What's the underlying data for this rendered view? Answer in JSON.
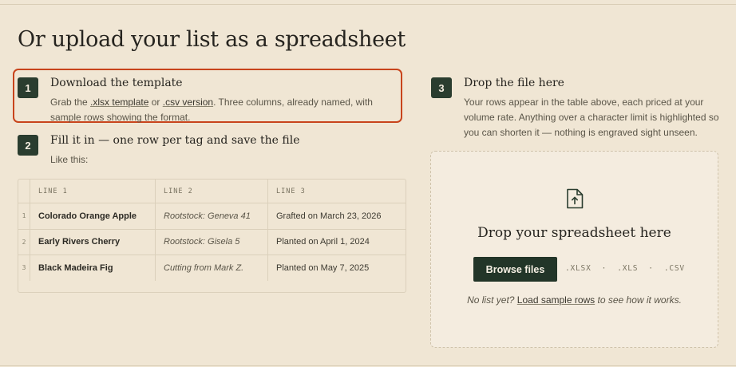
{
  "page": {
    "title": "Or upload your list as a spreadsheet"
  },
  "steps": [
    {
      "number": "1",
      "title": "Download the template",
      "desc_prefix": "Grab the ",
      "link_xlsx": ".xlsx template",
      "desc_or": " or ",
      "link_csv": ".csv version",
      "desc_suffix": ". Three columns, already named, with sample rows showing the format."
    },
    {
      "number": "2",
      "title": "Fill it in — one row per tag and save the file",
      "desc": "Like this:"
    },
    {
      "number": "3",
      "title": "Drop the file here",
      "desc": "Your rows appear in the table above, each priced at your volume rate. Anything over a character limit is highlighted so you can shorten it — nothing is engraved sight unseen."
    }
  ],
  "sample_table": {
    "headers": [
      "LINE 1",
      "LINE 2",
      "LINE 3"
    ],
    "rows": [
      {
        "index": "1",
        "line1": "Colorado Orange Apple",
        "line2": "Rootstock: Geneva 41",
        "line3": "Grafted on March 23, 2026"
      },
      {
        "index": "2",
        "line1": "Early Rivers Cherry",
        "line2": "Rootstock: Gisela 5",
        "line3": "Planted on April 1, 2024"
      },
      {
        "index": "3",
        "line1": "Black Madeira Fig",
        "line2": "Cutting from Mark Z.",
        "line3": "Planted on May 7, 2025"
      }
    ]
  },
  "dropzone": {
    "icon": "file-upload-icon",
    "title": "Drop your spreadsheet here",
    "browse_label": "Browse files",
    "formats": ".XLSX  ·  .XLS  ·  .CSV",
    "note_prefix": "No list yet? ",
    "note_link": "Load sample rows",
    "note_suffix": " to see how it works."
  },
  "colors": {
    "background": "#f0e6d4",
    "badge": "#2a3d2f",
    "button": "#223528",
    "highlight": "#c8441c"
  }
}
